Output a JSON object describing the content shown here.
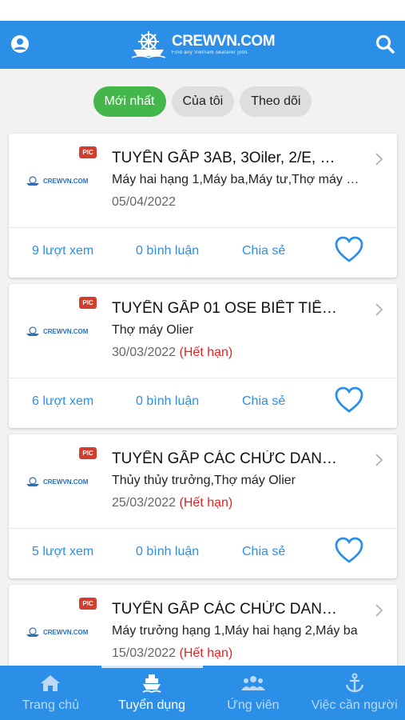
{
  "header": {
    "brand": "CREWVN.COM",
    "tagline": "Find any Vietnam seafarer jobs",
    "left_icon": "user-icon",
    "right_icon": "search-icon"
  },
  "tabs": [
    {
      "label": "Mới nhất",
      "active": true
    },
    {
      "label": "Của tôi",
      "active": false
    },
    {
      "label": "Theo dõi",
      "active": false
    }
  ],
  "posts": [
    {
      "title": "TUYỂN GẤP 3AB, 3Oiler, 2/E, …",
      "subtitle": "Máy hai hạng 1,Máy ba,Máy tư,Thợ máy …",
      "date": "05/04/2022",
      "expired_label": "",
      "views": "9 lượt xem",
      "comments": "0 bình luận",
      "share": "Chia sẻ",
      "badge": "PIC",
      "thumb_text": "CREWVN.COM"
    },
    {
      "title": "TUYỂN GẤP 01 OSE BIẾT TIẾ…",
      "subtitle": "Thợ máy Olier",
      "date": "30/03/2022",
      "expired_label": "(Hết hạn)",
      "views": "6 lượt xem",
      "comments": "0 bình luận",
      "share": "Chia sẻ",
      "badge": "PIC",
      "thumb_text": "CREWVN.COM"
    },
    {
      "title": "TUYỂN GẤP CÁC CHỨC DAN…",
      "subtitle": "Thủy thủy trưởng,Thợ máy Olier",
      "date": "25/03/2022",
      "expired_label": "(Hết hạn)",
      "views": "5 lượt xem",
      "comments": "0 bình luận",
      "share": "Chia sẻ",
      "badge": "PIC",
      "thumb_text": "CREWVN.COM"
    },
    {
      "title": "TUYỂN GẤP CÁC CHỨC DAN…",
      "subtitle": "Máy trưởng hạng 1,Máy hai hạng 2,Máy ba",
      "date": "15/03/2022",
      "expired_label": "(Hết hạn)",
      "views": "",
      "comments": "",
      "share": "",
      "badge": "PIC",
      "thumb_text": "CREWVN.COM"
    }
  ],
  "bottom_nav": [
    {
      "label": "Trang chủ",
      "icon": "home-icon",
      "active": false
    },
    {
      "label": "Tuyển dụng",
      "icon": "ship-icon",
      "active": true
    },
    {
      "label": "Ứng viên",
      "icon": "users-icon",
      "active": false
    },
    {
      "label": "Việc cần người",
      "icon": "anchor-icon",
      "active": false
    }
  ],
  "colors": {
    "primary": "#2b8fe8",
    "active_tab": "#43b74a",
    "expired": "#e02424",
    "badge": "#d33d2e"
  }
}
